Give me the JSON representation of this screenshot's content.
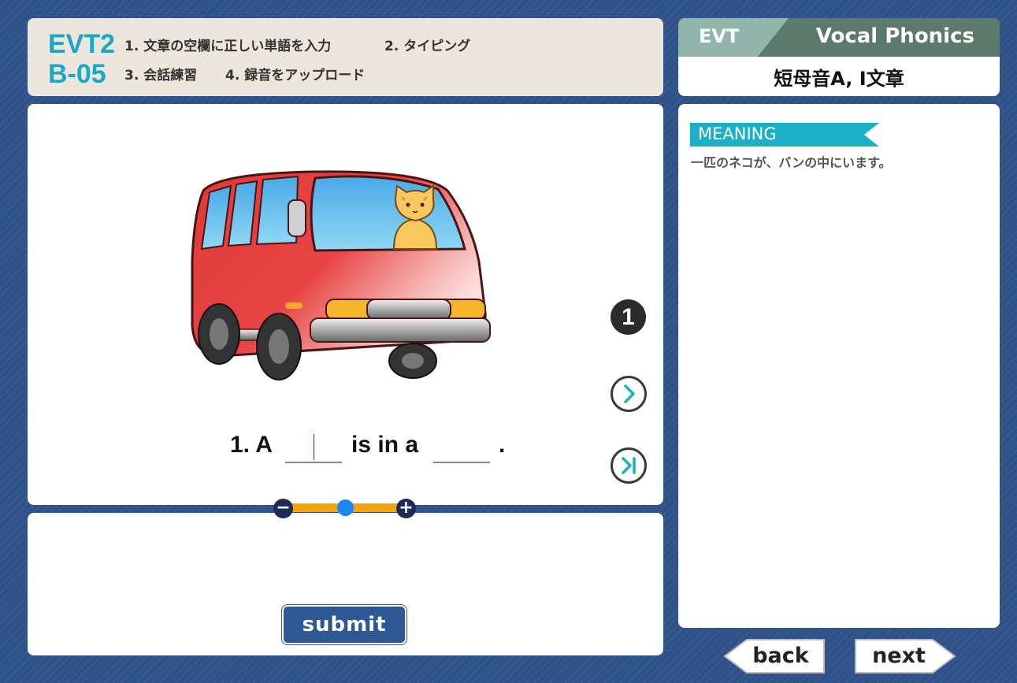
{
  "header": {
    "unit_line1": "EVT2",
    "unit_line2": "B-05",
    "steps": [
      "1. 文章の空欄に正しい単語を入力",
      "2. タイピング",
      "3. 会話練習",
      "4. 録音をアップロード"
    ]
  },
  "title_card": {
    "tab": "EVT",
    "brand": "Vocal Phonics",
    "lesson_title": "短母音A, I文章"
  },
  "exercise": {
    "number": "1",
    "sentence_prefix": "1. A",
    "sentence_middle": "is in a",
    "sentence_end": ".",
    "blank1_value": "",
    "blank2_value": "",
    "image_icon": "red-van-with-cat",
    "slider_level": 0.5
  },
  "nav_icons": {
    "next_question": "chevron-right-icon",
    "last_question": "skip-to-end-icon"
  },
  "answer": {
    "submit_label": "submit"
  },
  "meaning": {
    "tag": "MEANING",
    "text": "一匹のネコが、バンの中にいます。"
  },
  "page_nav": {
    "back_label": "back",
    "next_label": "next"
  },
  "colors": {
    "background": "#2f5289",
    "accent": "#1ba8c6",
    "slider": "#f6a400",
    "submit": "#2d5894"
  }
}
